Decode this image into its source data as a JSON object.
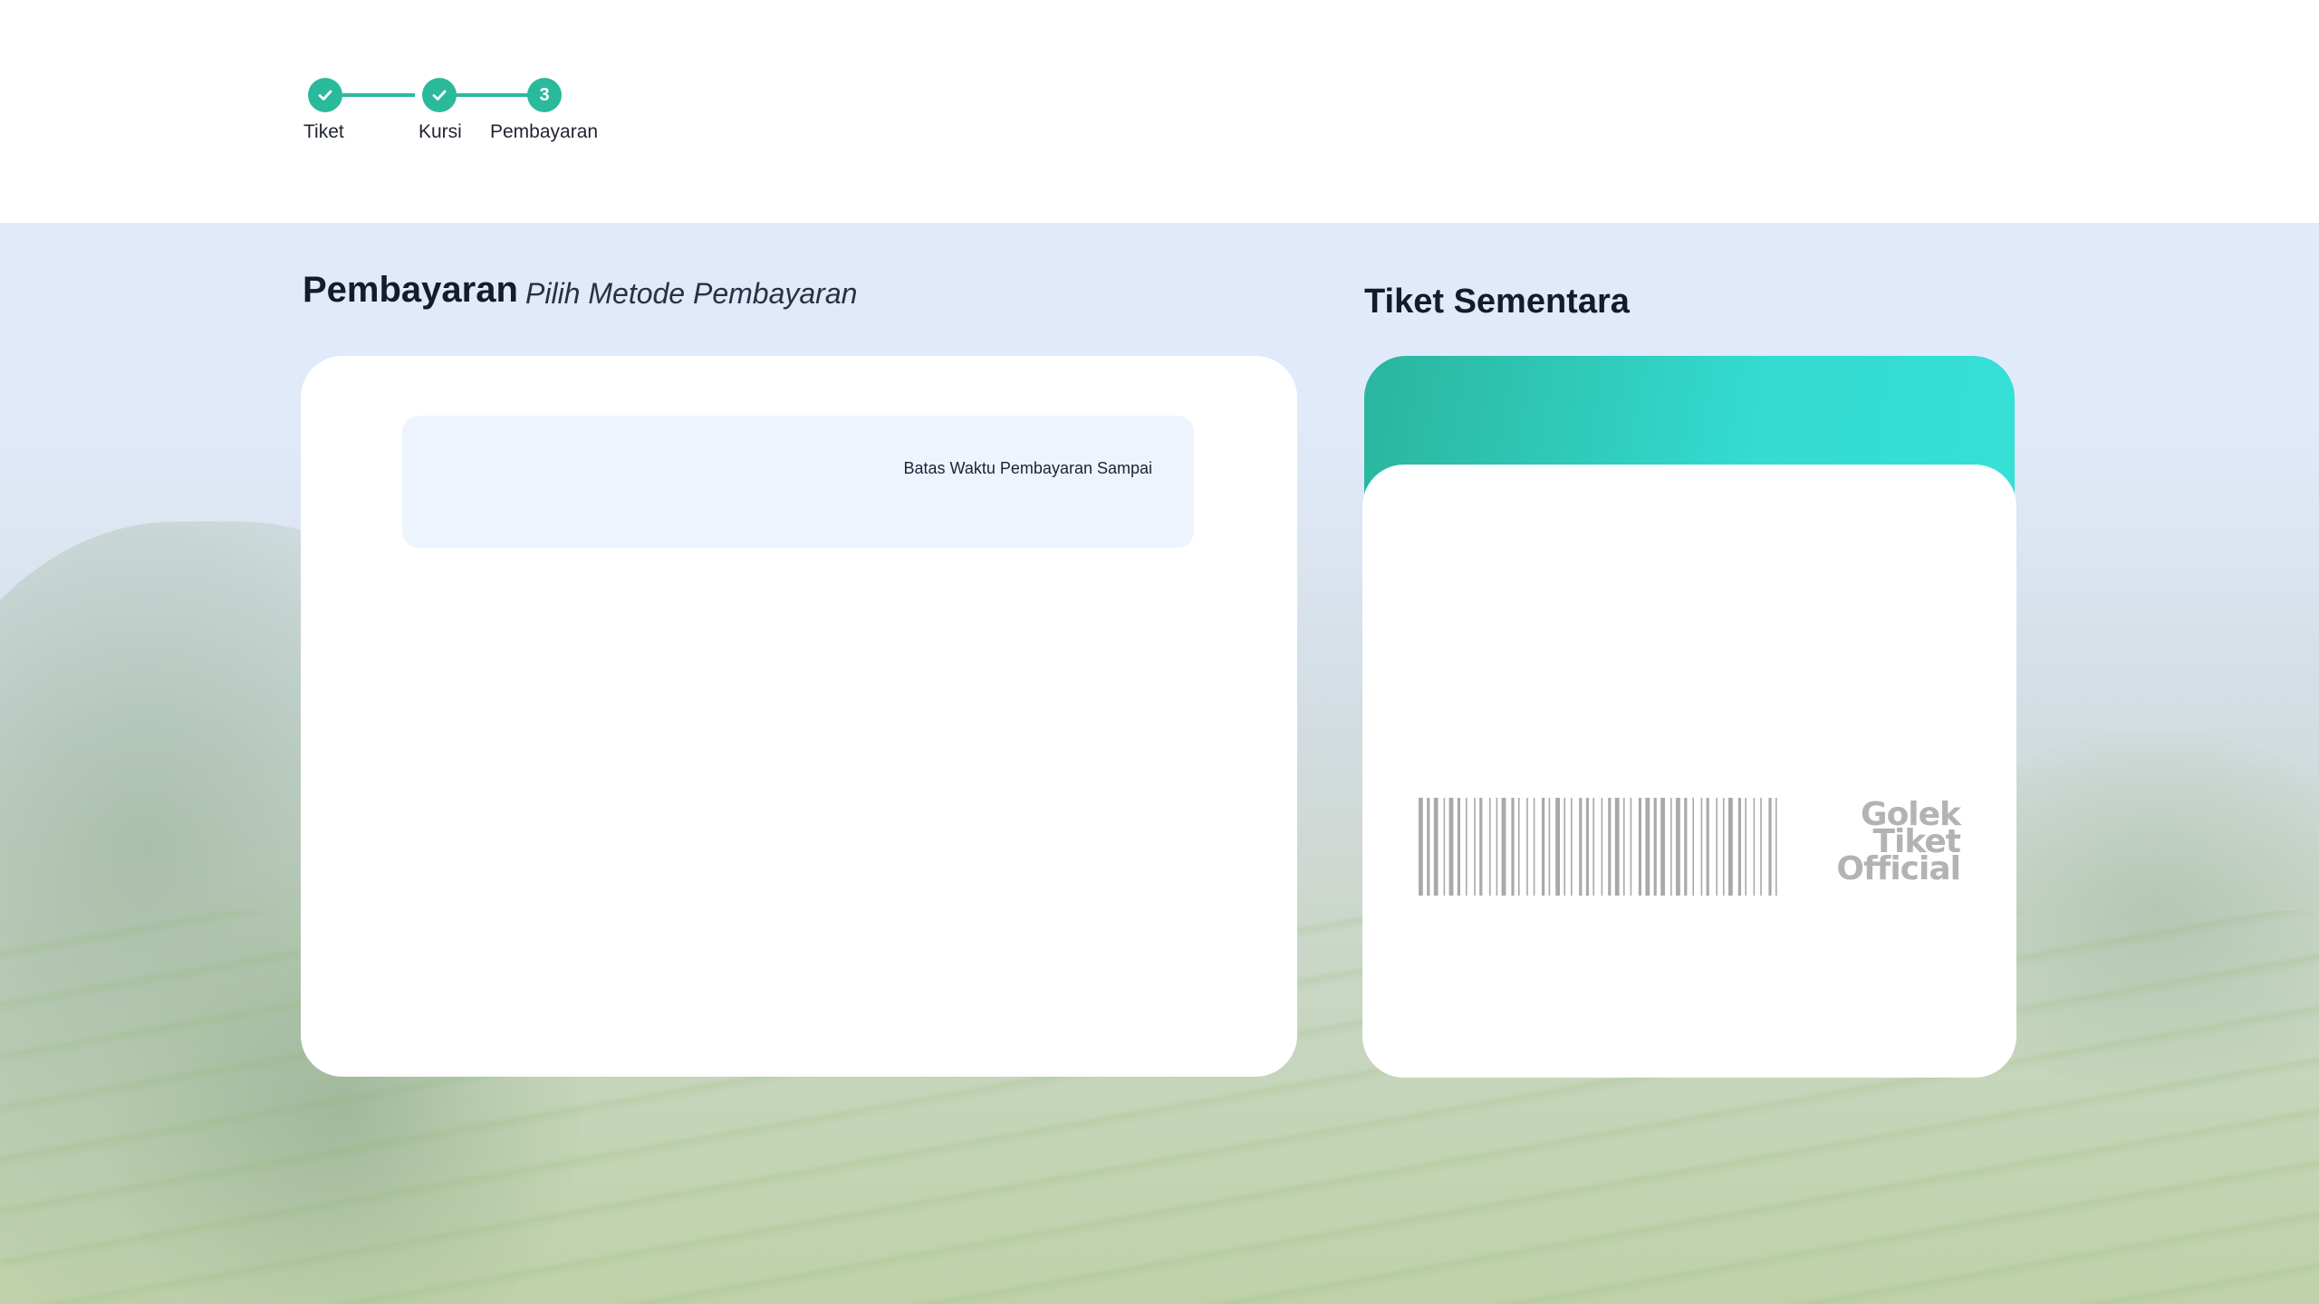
{
  "stepper": {
    "steps": [
      {
        "label": "Tiket",
        "state": "done"
      },
      {
        "label": "Kursi",
        "state": "done"
      },
      {
        "label": "Pembayaran",
        "state": "current",
        "number": "3"
      }
    ],
    "accent_color": "#2bb99c"
  },
  "payment": {
    "title": "Pembayaran",
    "subtitle": "Pilih Metode Pembayaran",
    "deadline_label": "Batas Waktu Pembayaran Sampai"
  },
  "ticket": {
    "title": "Tiket Sementara",
    "brand_lines": [
      "Golek",
      "Tiket",
      "Official"
    ],
    "header_gradient": [
      "#2ab59e",
      "#35e0d6"
    ]
  }
}
